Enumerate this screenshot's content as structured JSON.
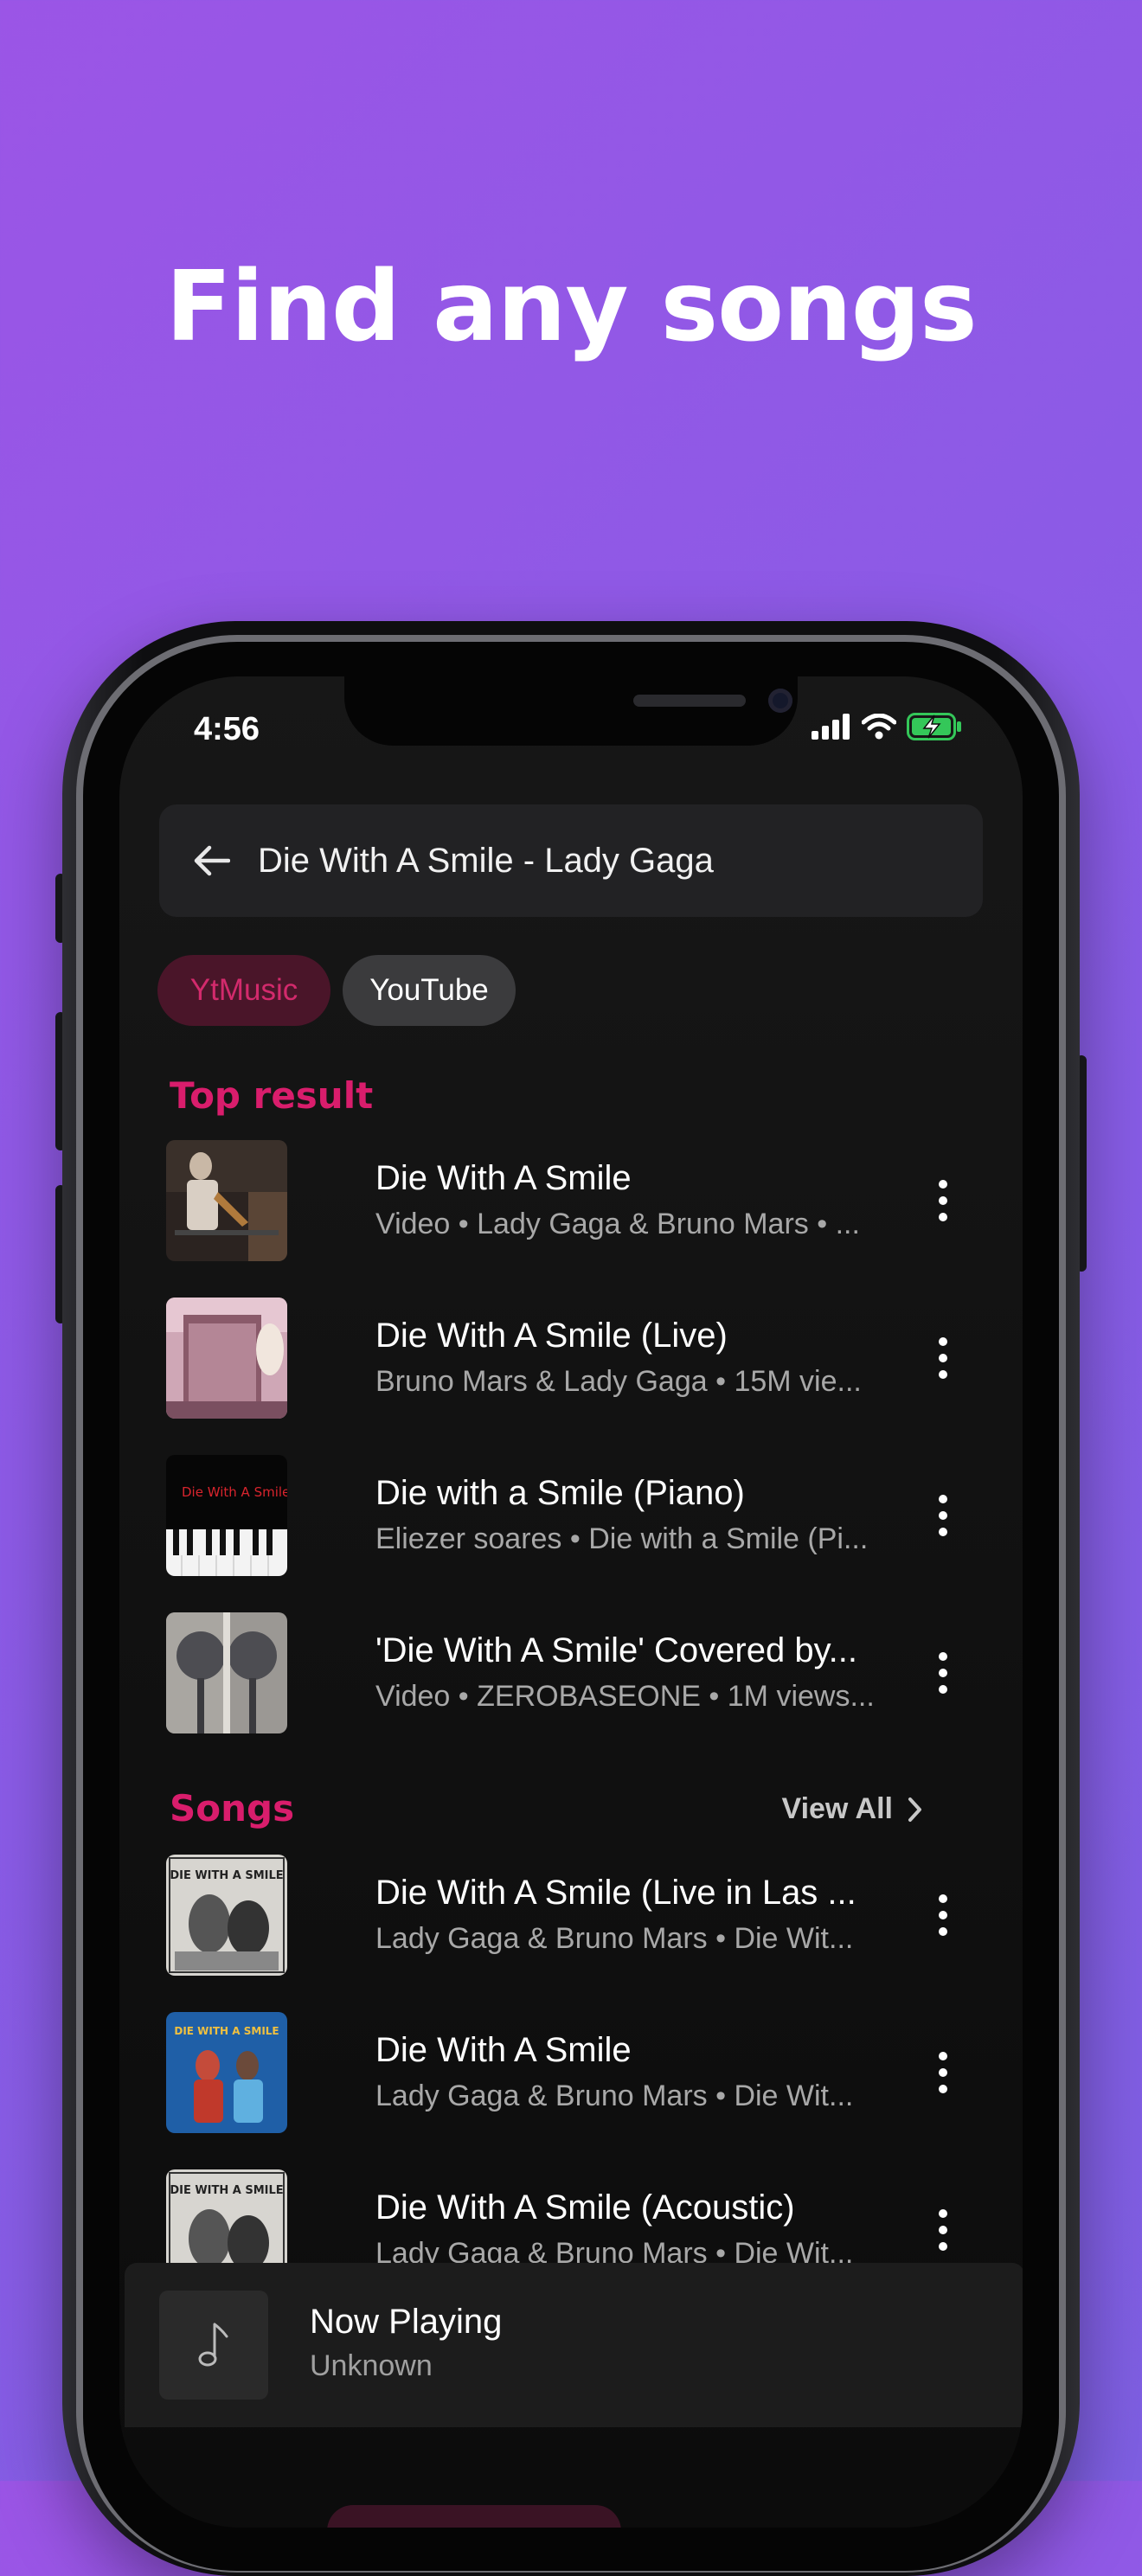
{
  "headline": "Find any songs",
  "status_bar": {
    "time": "4:56"
  },
  "search": {
    "query": "Die With A Smile - Lady Gaga"
  },
  "filters": [
    {
      "label": "YtMusic",
      "selected": true
    },
    {
      "label": "YouTube",
      "selected": false
    }
  ],
  "top_result": {
    "title": "Top result",
    "items": [
      {
        "title": "Die With A Smile",
        "subtitle": "Video • Lady Gaga & Bruno Mars • ..."
      },
      {
        "title": "Die With A Smile (Live)",
        "subtitle": "Bruno Mars & Lady Gaga • 15M vie..."
      },
      {
        "title": "Die with a Smile (Piano)",
        "subtitle": "Eliezer soares • Die with a Smile (Pi..."
      },
      {
        "title": "'Die With A Smile' Covered by...",
        "subtitle": "Video • ZEROBASEONE • 1M views..."
      }
    ]
  },
  "songs": {
    "title": "Songs",
    "view_all": "View All",
    "items": [
      {
        "title": "Die With A Smile (Live in Las ...",
        "subtitle": "Lady Gaga & Bruno Mars • Die Wit..."
      },
      {
        "title": "Die With A Smile",
        "subtitle": "Lady Gaga & Bruno Mars • Die Wit..."
      },
      {
        "title": "Die With A Smile (Acoustic)",
        "subtitle": "Lady Gaga & Bruno Mars • Die Wit..."
      }
    ]
  },
  "mini_player": {
    "title": "Now Playing",
    "subtitle": "Unknown"
  },
  "colors": {
    "accent": "#d91d6c",
    "background_gradient_start": "#9b55e6",
    "background_gradient_end": "#7e5fe2"
  },
  "icons": [
    "arrow-back-icon",
    "more-vert-icon",
    "chevron-right-icon",
    "music-note-icon",
    "signal-icon",
    "wifi-icon",
    "battery-charging-icon"
  ]
}
